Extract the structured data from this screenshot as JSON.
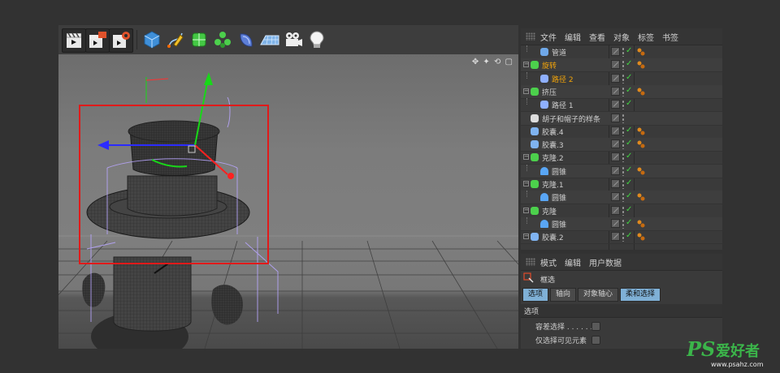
{
  "toolbar": {
    "buttons": [
      {
        "name": "render-view",
        "icon": "clapper-icon"
      },
      {
        "name": "render-to-picture-viewer",
        "icon": "clapper-render-icon"
      },
      {
        "name": "render-settings",
        "icon": "clapper-gear-icon"
      },
      {
        "name": "cube",
        "icon": "cube-icon"
      },
      {
        "name": "pen-spline",
        "icon": "pen-icon"
      },
      {
        "name": "subdivision-surface",
        "icon": "subdivision-icon"
      },
      {
        "name": "cloner",
        "icon": "cloner-icon"
      },
      {
        "name": "deformer",
        "icon": "deformer-icon"
      },
      {
        "name": "floor",
        "icon": "floor-icon"
      },
      {
        "name": "camera",
        "icon": "camera-icon"
      },
      {
        "name": "light",
        "icon": "bulb-icon"
      }
    ]
  },
  "viewport": {
    "controls": "✥ ✦ ⟲ ▢"
  },
  "object_manager": {
    "menu": [
      "文件",
      "编辑",
      "查看",
      "对象",
      "标签",
      "书签"
    ],
    "rows": [
      {
        "label": "管道",
        "indent": 1,
        "icon": "cylinder-icon",
        "selected": false,
        "expander": "",
        "tags": 1
      },
      {
        "label": "旋转",
        "indent": 0,
        "icon": "lathe-icon",
        "selected": true,
        "expander": "-",
        "tags": 1
      },
      {
        "label": "路径 2",
        "indent": 1,
        "icon": "spline-icon",
        "selected": true,
        "expander": "",
        "tags": 0
      },
      {
        "label": "挤压",
        "indent": 0,
        "icon": "extrude-icon",
        "selected": false,
        "expander": "-",
        "tags": 1
      },
      {
        "label": "路径 1",
        "indent": 1,
        "icon": "spline-icon",
        "selected": false,
        "expander": "",
        "tags": 0
      },
      {
        "label": "胡子和帽子的样条",
        "indent": 0,
        "icon": "null-icon",
        "selected": false,
        "expander": "",
        "tags": 0
      },
      {
        "label": "胶囊.4",
        "indent": 0,
        "icon": "capsule-icon",
        "selected": false,
        "expander": "",
        "tags": 1
      },
      {
        "label": "胶囊.3",
        "indent": 0,
        "icon": "capsule-icon",
        "selected": false,
        "expander": "",
        "tags": 1
      },
      {
        "label": "克隆.2",
        "indent": 0,
        "icon": "cloner-icon",
        "selected": false,
        "expander": "-",
        "tags": 0
      },
      {
        "label": "圆锥",
        "indent": 1,
        "icon": "cone-icon",
        "selected": false,
        "expander": "",
        "tags": 1
      },
      {
        "label": "克隆.1",
        "indent": 0,
        "icon": "cloner-icon",
        "selected": false,
        "expander": "-",
        "tags": 0
      },
      {
        "label": "圆锥",
        "indent": 1,
        "icon": "cone-icon",
        "selected": false,
        "expander": "",
        "tags": 1
      },
      {
        "label": "克隆",
        "indent": 0,
        "icon": "cloner-icon",
        "selected": false,
        "expander": "-",
        "tags": 0
      },
      {
        "label": "圆锥",
        "indent": 1,
        "icon": "cone-icon",
        "selected": false,
        "expander": "",
        "tags": 1
      },
      {
        "label": "胶囊.2",
        "indent": 0,
        "icon": "capsule-icon",
        "selected": false,
        "expander": "-",
        "tags": 1
      }
    ]
  },
  "attribute_manager": {
    "menu": [
      "模式",
      "编辑",
      "用户数据"
    ],
    "mode_title": "框选",
    "tabs": [
      {
        "label": "选项",
        "active": true
      },
      {
        "label": "轴向",
        "active": false
      },
      {
        "label": "对象轴心",
        "active": false
      },
      {
        "label": "柔和选择",
        "active": true
      }
    ],
    "section_title": "选项",
    "options": [
      {
        "label": "容差选择 . . . . . .",
        "checked": false
      },
      {
        "label": "仅选择可见元素",
        "checked": false
      }
    ]
  },
  "watermark": {
    "logo_text": "PS爱好者",
    "url": "www.psahz.com"
  }
}
